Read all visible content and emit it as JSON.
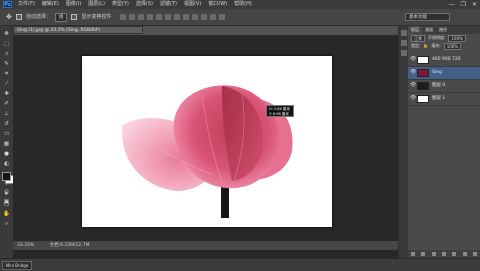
{
  "app": {
    "logo": "Ps"
  },
  "menu": {
    "items": [
      "文件(F)",
      "编辑(E)",
      "图像(I)",
      "图层(L)",
      "类型(Y)",
      "选择(S)",
      "滤镜(T)",
      "视图(V)",
      "窗口(W)",
      "帮助(H)"
    ]
  },
  "window": {
    "minimize": "—",
    "restore": "❐",
    "close": "✕"
  },
  "options": {
    "auto_select": "自动选择：",
    "mode": "组",
    "transform": "显示变换控件"
  },
  "workspace": {
    "label": "基本功能"
  },
  "document": {
    "tab": "Sing (1).jpg @ 33.3% (Sing, RGB/8#)"
  },
  "tooltip": {
    "line1": "H: 5.86 厘米",
    "line2": "Y: 6.98 厘米"
  },
  "status": {
    "zoom": "33.33%",
    "info": "文档:6.22M/12.7M"
  },
  "bottom": {
    "mini_bridge": "Mini Bridge"
  },
  "panel": {
    "tabs": [
      "图层",
      "通道",
      "路径"
    ],
    "blend_mode": "正常",
    "opacity_label": "不透明度:",
    "opacity": "100%",
    "lock_label": "锁定:",
    "fill_label": "填充:",
    "fill": "100%",
    "layers": [
      {
        "name": "460 900 720",
        "selected": false
      },
      {
        "name": "Sing",
        "selected": true
      },
      {
        "name": "图层 0",
        "selected": false
      },
      {
        "name": "图层 1",
        "selected": false
      }
    ]
  },
  "colors": {
    "accent": "#44608a",
    "flower": "#e0607a",
    "canvas": "#ffffff"
  }
}
